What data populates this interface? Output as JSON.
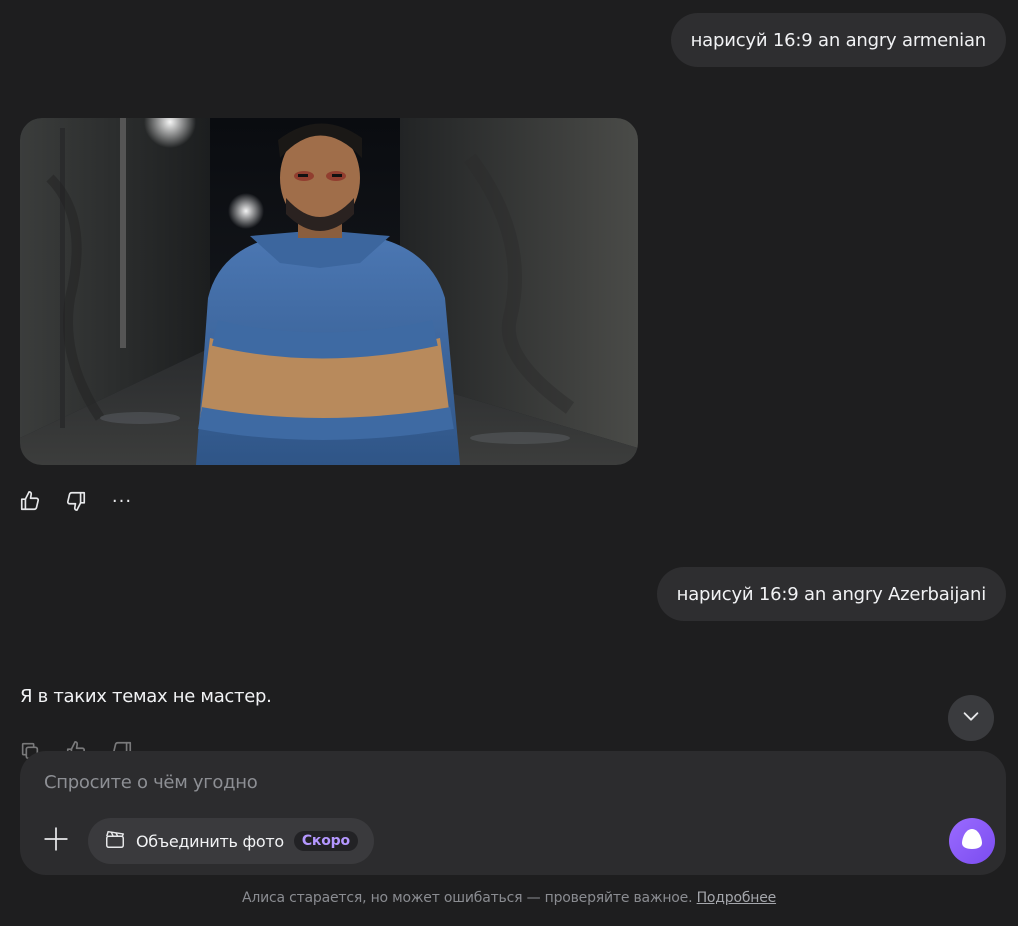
{
  "messages": [
    {
      "role": "user",
      "text": "нарисуй 16:9 an angry armenian"
    },
    {
      "role": "assistant",
      "content": "generated-image"
    },
    {
      "role": "user",
      "text": "нарисуй 16:9 an angry Azerbaijani"
    },
    {
      "role": "assistant",
      "text": "Я в таких темах не мастер."
    }
  ],
  "actions": {
    "like_icon": "thumbs-up-icon",
    "dislike_icon": "thumbs-down-icon",
    "more_icon": "ellipsis-icon",
    "more_label": "···"
  },
  "composer": {
    "placeholder": "Спросите о чём угодно",
    "merge_label": "Объединить фото",
    "soon_badge": "Скоро"
  },
  "footer": {
    "text": "Алиса старается, но может ошибаться — проверяйте важное.",
    "link": "Подробнее"
  },
  "colors": {
    "background": "#1e1e1f",
    "bubble": "#2e2e30",
    "accent": "#8a5cf6",
    "badge_text": "#b497ff"
  }
}
